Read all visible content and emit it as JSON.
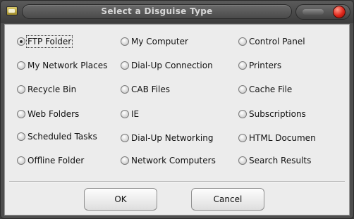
{
  "window": {
    "title": "Select a Disguise Type",
    "icon": "folder-icon",
    "close_color": "#e0261a"
  },
  "options": [
    {
      "label": "FTP Folder",
      "checked": true,
      "focused": true
    },
    {
      "label": "My Computer",
      "checked": false
    },
    {
      "label": "Control Panel",
      "checked": false
    },
    {
      "label": "My Network Places",
      "checked": false
    },
    {
      "label": "Dial-Up Connection",
      "checked": false
    },
    {
      "label": "Printers",
      "checked": false
    },
    {
      "label": "Recycle Bin",
      "checked": false
    },
    {
      "label": "CAB Files",
      "checked": false
    },
    {
      "label": "Cache File",
      "checked": false
    },
    {
      "label": "Web Folders",
      "checked": false
    },
    {
      "label": "IE",
      "checked": false
    },
    {
      "label": "Subscriptions",
      "checked": false
    },
    {
      "label": "Scheduled Tasks",
      "checked": false
    },
    {
      "label": "Dial-Up Networking",
      "checked": false
    },
    {
      "label": "HTML Documen",
      "checked": false
    },
    {
      "label": "Offline Folder",
      "checked": false
    },
    {
      "label": "Network Computers",
      "checked": false
    },
    {
      "label": "Search Results",
      "checked": false
    }
  ],
  "buttons": {
    "ok_label": "OK",
    "cancel_label": "Cancel"
  }
}
